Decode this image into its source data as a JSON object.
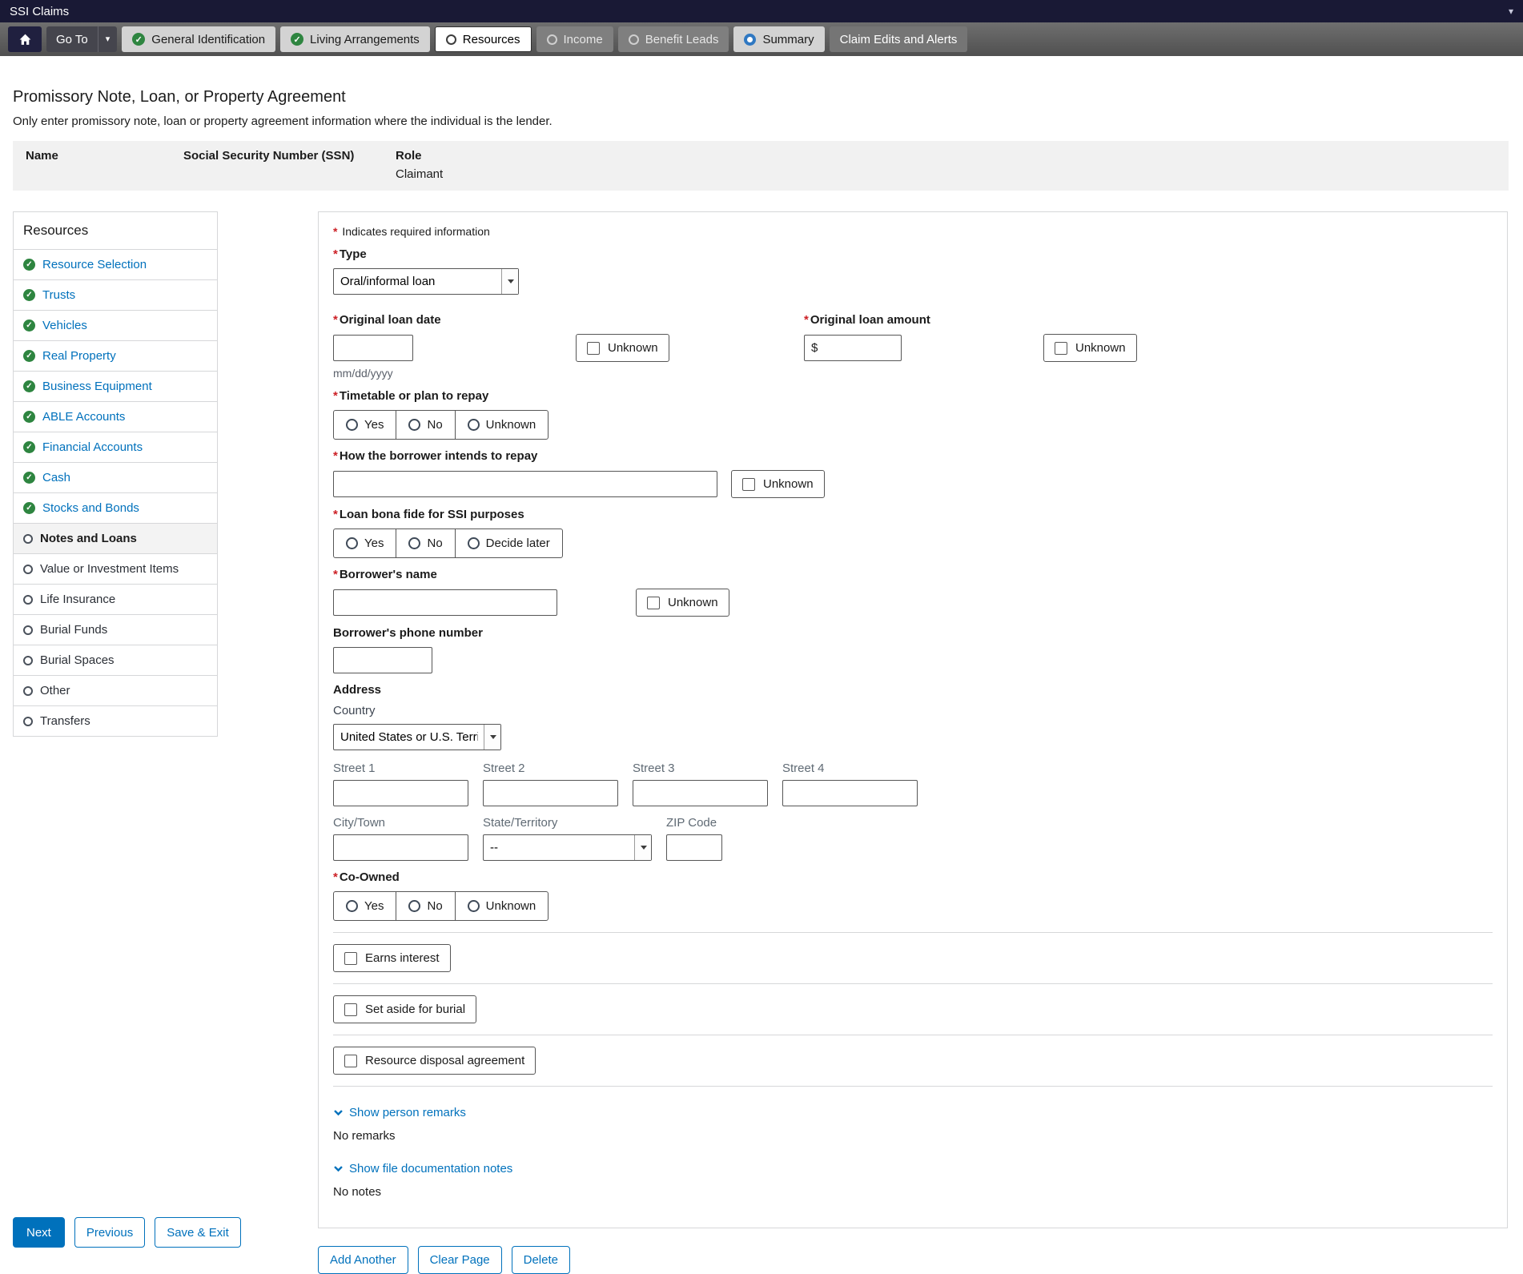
{
  "app": {
    "title": "SSI Claims"
  },
  "icons": {
    "check": "✓",
    "caret_down": "▾"
  },
  "nav": {
    "go_to_label": "Go To",
    "tabs": [
      {
        "label": "General Identification",
        "state": "complete"
      },
      {
        "label": "Living Arrangements",
        "state": "complete"
      },
      {
        "label": "Resources",
        "state": "active"
      },
      {
        "label": "Income",
        "state": "disabled"
      },
      {
        "label": "Benefit Leads",
        "state": "disabled"
      },
      {
        "label": "Summary",
        "state": "ready"
      },
      {
        "label": "Claim Edits and Alerts",
        "state": "plain"
      }
    ]
  },
  "page": {
    "title": "Promissory Note, Loan, or Property Agreement",
    "subtitle": "Only enter promissory note, loan or property agreement information where the individual is the lender.",
    "person": {
      "name_label": "Name",
      "ssn_label": "Social Security Number (SSN)",
      "role_label": "Role",
      "role_value": "Claimant"
    }
  },
  "sidebar": {
    "title": "Resources",
    "items": [
      {
        "label": "Resource Selection",
        "state": "complete"
      },
      {
        "label": "Trusts",
        "state": "complete"
      },
      {
        "label": "Vehicles",
        "state": "complete"
      },
      {
        "label": "Real Property",
        "state": "complete"
      },
      {
        "label": "Business Equipment",
        "state": "complete"
      },
      {
        "label": "ABLE Accounts",
        "state": "complete"
      },
      {
        "label": "Financial Accounts",
        "state": "complete"
      },
      {
        "label": "Cash",
        "state": "complete"
      },
      {
        "label": "Stocks and Bonds",
        "state": "complete"
      },
      {
        "label": "Notes and Loans",
        "state": "current"
      },
      {
        "label": "Value or Investment Items",
        "state": "pending"
      },
      {
        "label": "Life Insurance",
        "state": "pending"
      },
      {
        "label": "Burial Funds",
        "state": "pending"
      },
      {
        "label": "Burial Spaces",
        "state": "pending"
      },
      {
        "label": "Other",
        "state": "pending"
      },
      {
        "label": "Transfers",
        "state": "pending"
      }
    ]
  },
  "form": {
    "required_marker": "*",
    "required_note": "Indicates required information",
    "type": {
      "label": "Type",
      "value": "Oral/informal loan"
    },
    "original_loan_date": {
      "label": "Original loan date",
      "value": "",
      "hint": "mm/dd/yyyy",
      "unknown_label": "Unknown"
    },
    "original_loan_amount": {
      "label": "Original loan amount",
      "prefix": "$",
      "value": "",
      "unknown_label": "Unknown"
    },
    "timetable": {
      "label": "Timetable or plan to repay",
      "options": [
        {
          "label": "Yes"
        },
        {
          "label": "No"
        },
        {
          "label": "Unknown"
        }
      ]
    },
    "repay_method": {
      "label": "How the borrower intends to repay",
      "value": "",
      "unknown_label": "Unknown"
    },
    "bona_fide": {
      "label": "Loan bona fide for SSI purposes",
      "options": [
        {
          "label": "Yes"
        },
        {
          "label": "No"
        },
        {
          "label": "Decide later"
        }
      ]
    },
    "borrower_name": {
      "label": "Borrower's name",
      "value": "",
      "unknown_label": "Unknown"
    },
    "borrower_phone": {
      "label": "Borrower's phone number",
      "value": ""
    },
    "address": {
      "label": "Address",
      "country": {
        "label": "Country",
        "value": "United States or U.S. Territory"
      },
      "street1_label": "Street 1",
      "street2_label": "Street 2",
      "street3_label": "Street 3",
      "street4_label": "Street 4",
      "city_label": "City/Town",
      "state": {
        "label": "State/Territory",
        "value": "--"
      },
      "zip_label": "ZIP Code"
    },
    "co_owned": {
      "label": "Co-Owned",
      "options": [
        {
          "label": "Yes"
        },
        {
          "label": "No"
        },
        {
          "label": "Unknown"
        }
      ]
    },
    "earns_interest_label": "Earns interest",
    "set_aside_label": "Set aside for burial",
    "disposal_label": "Resource disposal agreement",
    "person_remarks": {
      "link_label": "Show person remarks",
      "empty_text": "No remarks"
    },
    "file_notes": {
      "link_label": "Show file documentation notes",
      "empty_text": "No notes"
    }
  },
  "actions": {
    "add_another": "Add Another",
    "clear_page": "Clear Page",
    "delete": "Delete"
  },
  "footer": {
    "next": "Next",
    "previous": "Previous",
    "save_exit": "Save & Exit"
  },
  "colors": {
    "accent": "#0071bc",
    "header_bar": "#191935",
    "success_green": "#2e8540",
    "required_red": "#cc2026",
    "nav_bar_gray": "#5f5f5f",
    "band_gray": "#f1f1f1"
  }
}
